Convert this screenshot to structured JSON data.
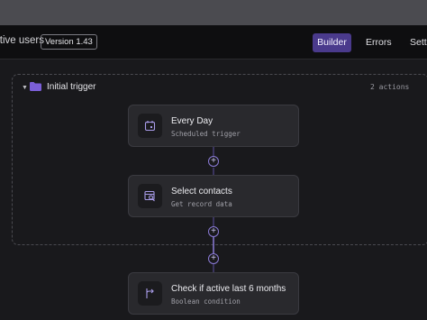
{
  "header": {
    "title": "ctive users",
    "version": "Version 1.43",
    "tabs": [
      {
        "label": "Builder",
        "active": true
      },
      {
        "label": "Errors",
        "active": false
      },
      {
        "label": "Setti",
        "active": false
      }
    ]
  },
  "group": {
    "title": "Initial trigger",
    "count": "2 actions"
  },
  "cards": [
    {
      "title": "Every Day",
      "subtitle": "Scheduled trigger",
      "icon": "calendar-icon"
    },
    {
      "title": "Select contacts",
      "subtitle": "Get record data",
      "icon": "table-search-icon"
    },
    {
      "title": "Check if active last 6 months",
      "subtitle": "Boolean condition",
      "icon": "branch-icon"
    }
  ],
  "colors": {
    "accent": "#4a3a8c",
    "connector": "#8a7ad6",
    "folder": "#7b5fd8",
    "background": "#19191c"
  }
}
